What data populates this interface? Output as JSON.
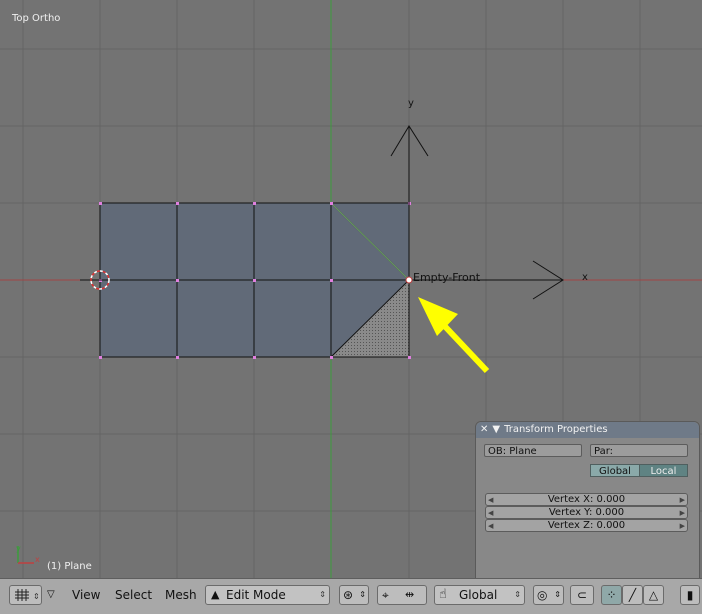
{
  "viewport": {
    "view_name": "Top Ortho",
    "object_label": "(1) Plane",
    "empty_label": "Empty-Front",
    "axis_y_label": "y",
    "axis_x_label": "x"
  },
  "transform_panel": {
    "title": "Transform Properties",
    "ob_field": "OB: Plane",
    "par_field": "Par:",
    "global_btn": "Global",
    "local_btn": "Local",
    "vertex_x": "Vertex X: 0.000",
    "vertex_y": "Vertex Y: 0.000",
    "vertex_z": "Vertex Z: 0.000"
  },
  "header": {
    "menu_view": "View",
    "menu_select": "Select",
    "menu_mesh": "Mesh",
    "mode": "Edit Mode",
    "orientation": "Global"
  },
  "colors": {
    "viewport_bg": "#737373",
    "mesh_face": "#616a78",
    "arrow": "#ffff00",
    "x_axis": "#c04040",
    "y_axis": "#3c9c3c"
  }
}
